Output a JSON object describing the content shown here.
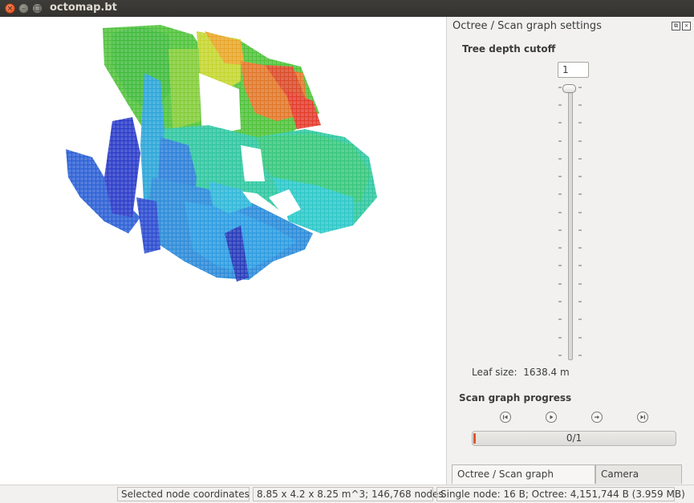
{
  "window": {
    "title": "octomap.bt"
  },
  "panel": {
    "title": "Octree / Scan graph settings",
    "tree_depth_label": "Tree depth cutoff",
    "tree_depth_value": "1",
    "leaf_size_label": "Leaf size:",
    "leaf_size_value": "1638.4 m",
    "scan_progress_label": "Scan graph progress",
    "progress_text": "0/1",
    "progress_fraction": 0.0,
    "playback_controls": [
      "skip-back-icon",
      "play-icon",
      "step-forward-icon",
      "skip-forward-icon"
    ]
  },
  "tabs": [
    {
      "label": "Octree / Scan graph settings",
      "active": true
    },
    {
      "label": "Camera settings",
      "active": false
    }
  ],
  "status": {
    "selected": "Selected node coordinates",
    "dims": "8.85 x 4.2 x 8.25 m^3; 146,768 nodes",
    "memory": "Single node: 16 B; Octree: 4,151,744 B (3.959 MB)"
  },
  "colors": {
    "accent": "#e1562a",
    "titlebar": "#3c3b37"
  }
}
